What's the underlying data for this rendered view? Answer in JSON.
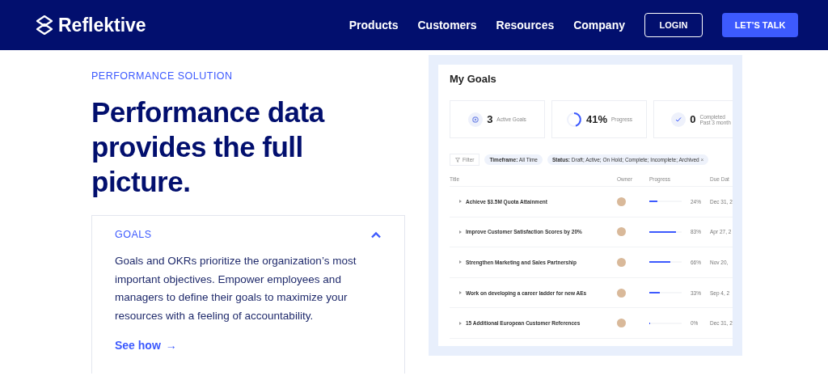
{
  "nav": {
    "brand": "Reflektive",
    "links": [
      "Products",
      "Customers",
      "Resources",
      "Company"
    ],
    "login": "LOGIN",
    "cta": "LET’S TALK"
  },
  "hero": {
    "eyebrow": "PERFORMANCE SOLUTION",
    "headline": "Performance data provides the full picture."
  },
  "accordion": {
    "title": "GOALS",
    "expanded": true,
    "body": "Goals and OKRs prioritize the organization’s most important objectives. Empower employees and managers to define their goals to maximize your resources with a feeling of accountability.",
    "link": "See how",
    "link_arrow": "→"
  },
  "goals_panel": {
    "title": "My Goals",
    "stats": [
      {
        "kind": "target",
        "value": "3",
        "label": "Active Goals"
      },
      {
        "kind": "ring",
        "value": "41%",
        "label": "Progress"
      },
      {
        "kind": "check",
        "value": "0",
        "label": "Completed",
        "sublabel": "Past 3 month"
      }
    ],
    "filters": [
      {
        "kind": "button",
        "text": "Filter"
      },
      {
        "kind": "chip",
        "key": "Timeframe:",
        "text": "All Time"
      },
      {
        "kind": "chip",
        "key": "Status:",
        "text": "Draft; Active; On Hold; Complete; Incomplete; Archived",
        "close": "×"
      }
    ],
    "columns": [
      "Title",
      "Owner",
      "Progress",
      "Due Dat"
    ],
    "rows": [
      {
        "title": "Achieve $3.5M Quota Attainment",
        "level": 0.24,
        "percent": "24%",
        "due": "Dec 31, 2"
      },
      {
        "title": "Improve Customer Satisfaction Scores by 20%",
        "level": 0.83,
        "percent": "83%",
        "due": "Apr 27, 2"
      },
      {
        "title": "Strengthen Marketing and Sales Partnership",
        "level": 0.66,
        "percent": "66%",
        "due": "Nov 20,"
      },
      {
        "title": "Work on developing a career ladder for new AEs",
        "level": 0.33,
        "percent": "33%",
        "due": "Sep 4, 2"
      },
      {
        "title": "15 Additional European Customer References",
        "level": 0,
        "percent": "0%",
        "due": "Dec 31, 2"
      }
    ]
  }
}
